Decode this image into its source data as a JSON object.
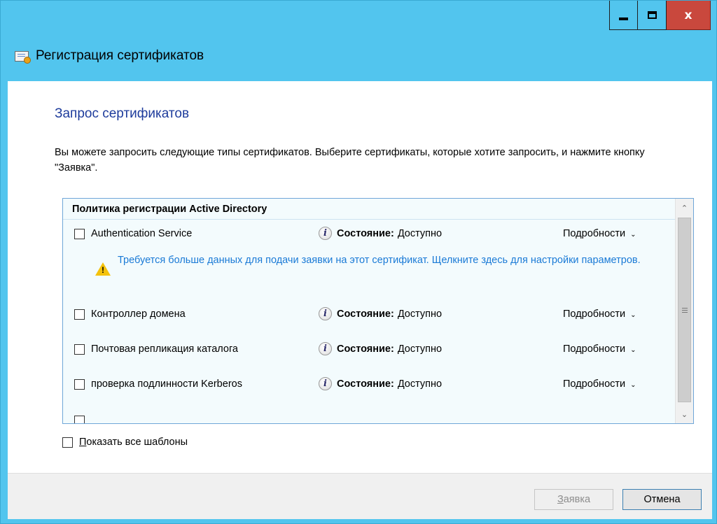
{
  "window": {
    "title": "Регистрация сертификатов",
    "controls": {
      "minimize": "_",
      "maximize": "□",
      "close": "x"
    }
  },
  "page": {
    "heading": "Запрос сертификатов",
    "description": "Вы можете запросить следующие типы сертификатов. Выберите сертификаты, которые хотите запросить, и нажмите кнопку \"Заявка\"."
  },
  "policy": {
    "header": "Политика регистрации Active Directory",
    "status_label": "Состояние:",
    "details_label": "Подробности",
    "items": [
      {
        "name": "Authentication Service",
        "status": "Доступно",
        "checked": false
      },
      {
        "name": "Контроллер домена",
        "status": "Доступно",
        "checked": false
      },
      {
        "name": "Почтовая репликация каталога",
        "status": "Доступно",
        "checked": false
      },
      {
        "name": "проверка подлинности Kerberos",
        "status": "Доступно",
        "checked": false
      }
    ],
    "warning": "Требуется больше данных для подачи заявки на этот сертификат. Щелкните здесь для настройки параметров."
  },
  "options": {
    "show_all_accel": "П",
    "show_all_rest": "оказать все шаблоны"
  },
  "footer": {
    "enroll_accel": "З",
    "enroll_rest": "аявка",
    "cancel_label": "Отмена"
  },
  "colors": {
    "frame": "#52c5ee",
    "heading": "#1e3c9c",
    "link": "#1a7ad6",
    "close_button": "#c9483d"
  }
}
